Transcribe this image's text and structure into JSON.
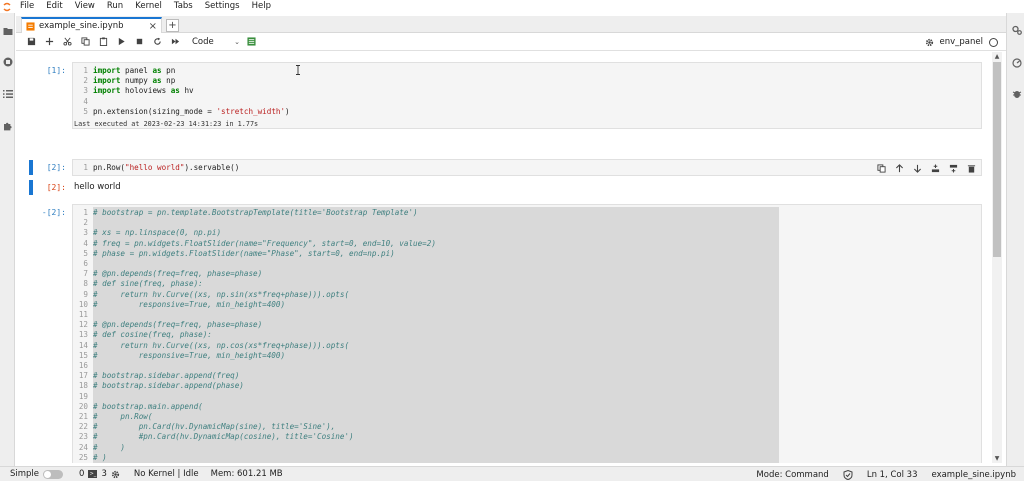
{
  "menu": [
    "File",
    "Edit",
    "View",
    "Run",
    "Kernel",
    "Tabs",
    "Settings",
    "Help"
  ],
  "tab": {
    "label": "example_sine.ipynb",
    "close": "×",
    "new": "+"
  },
  "toolbar": {
    "cell_type": "Code",
    "kernel_name": "env_panel"
  },
  "cells": [
    {
      "prompt": "[1]:",
      "lines": [
        {
          "n": "1",
          "parts": [
            {
              "t": "import",
              "c": "kw"
            },
            {
              "t": " panel ",
              "c": ""
            },
            {
              "t": "as",
              "c": "kw"
            },
            {
              "t": " pn",
              "c": ""
            }
          ]
        },
        {
          "n": "2",
          "parts": [
            {
              "t": "import",
              "c": "kw"
            },
            {
              "t": " numpy ",
              "c": ""
            },
            {
              "t": "as",
              "c": "kw"
            },
            {
              "t": " np",
              "c": ""
            }
          ]
        },
        {
          "n": "3",
          "parts": [
            {
              "t": "import",
              "c": "kw"
            },
            {
              "t": " holoviews ",
              "c": ""
            },
            {
              "t": "as",
              "c": "kw"
            },
            {
              "t": " hv",
              "c": ""
            }
          ]
        },
        {
          "n": "4",
          "parts": [
            {
              "t": "",
              "c": ""
            }
          ]
        },
        {
          "n": "5",
          "parts": [
            {
              "t": "pn.extension(sizing_mode = ",
              "c": ""
            },
            {
              "t": "'stretch_width'",
              "c": "str"
            },
            {
              "t": ")",
              "c": ""
            }
          ]
        }
      ],
      "exec_info": "Last executed at 2023-02-23 14:31:23 in 1.77s"
    },
    {
      "prompt": "[2]:",
      "lines": [
        {
          "n": "1",
          "parts": [
            {
              "t": "pn.Row(",
              "c": ""
            },
            {
              "t": "\"hello world\"",
              "c": "str"
            },
            {
              "t": ").servable()",
              "c": ""
            }
          ]
        }
      ],
      "output_prompt": "[2]:",
      "output": "hello world"
    },
    {
      "prompt": "-[2]:",
      "lines": [
        {
          "n": "1",
          "parts": [
            {
              "t": "# bootstrap = pn.template.BootstrapTemplate(title='Bootstrap Template')",
              "c": "cm"
            }
          ]
        },
        {
          "n": "2",
          "parts": [
            {
              "t": "",
              "c": ""
            }
          ]
        },
        {
          "n": "3",
          "parts": [
            {
              "t": "# xs = np.linspace(0, np.pi)",
              "c": "cm"
            }
          ]
        },
        {
          "n": "4",
          "parts": [
            {
              "t": "# freq = pn.widgets.FloatSlider(name=\"Frequency\", start=0, end=10, value=2)",
              "c": "cm"
            }
          ]
        },
        {
          "n": "5",
          "parts": [
            {
              "t": "# phase = pn.widgets.FloatSlider(name=\"Phase\", start=0, end=np.pi)",
              "c": "cm"
            }
          ]
        },
        {
          "n": "6",
          "parts": [
            {
              "t": "",
              "c": ""
            }
          ]
        },
        {
          "n": "7",
          "parts": [
            {
              "t": "# @pn.depends(freq=freq, phase=phase)",
              "c": "cm"
            }
          ]
        },
        {
          "n": "8",
          "parts": [
            {
              "t": "# def sine(freq, phase):",
              "c": "cm"
            }
          ]
        },
        {
          "n": "9",
          "parts": [
            {
              "t": "#     return hv.Curve((xs, np.sin(xs*freq+phase))).opts(",
              "c": "cm"
            }
          ]
        },
        {
          "n": "10",
          "parts": [
            {
              "t": "#         responsive=True, min_height=400)",
              "c": "cm"
            }
          ]
        },
        {
          "n": "11",
          "parts": [
            {
              "t": "",
              "c": ""
            }
          ]
        },
        {
          "n": "12",
          "parts": [
            {
              "t": "# @pn.depends(freq=freq, phase=phase)",
              "c": "cm"
            }
          ]
        },
        {
          "n": "13",
          "parts": [
            {
              "t": "# def cosine(freq, phase):",
              "c": "cm"
            }
          ]
        },
        {
          "n": "14",
          "parts": [
            {
              "t": "#     return hv.Curve((xs, np.cos(xs*freq+phase))).opts(",
              "c": "cm"
            }
          ]
        },
        {
          "n": "15",
          "parts": [
            {
              "t": "#         responsive=True, min_height=400)",
              "c": "cm"
            }
          ]
        },
        {
          "n": "16",
          "parts": [
            {
              "t": "",
              "c": ""
            }
          ]
        },
        {
          "n": "17",
          "parts": [
            {
              "t": "# bootstrap.sidebar.append(freq)",
              "c": "cm"
            }
          ]
        },
        {
          "n": "18",
          "parts": [
            {
              "t": "# bootstrap.sidebar.append(phase)",
              "c": "cm"
            }
          ]
        },
        {
          "n": "19",
          "parts": [
            {
              "t": "",
              "c": ""
            }
          ]
        },
        {
          "n": "20",
          "parts": [
            {
              "t": "# bootstrap.main.append(",
              "c": "cm"
            }
          ]
        },
        {
          "n": "21",
          "parts": [
            {
              "t": "#     pn.Row(",
              "c": "cm"
            }
          ]
        },
        {
          "n": "22",
          "parts": [
            {
              "t": "#         pn.Card(hv.DynamicMap(sine), title='Sine'),",
              "c": "cm"
            }
          ]
        },
        {
          "n": "23",
          "parts": [
            {
              "t": "#         #pn.Card(hv.DynamicMap(cosine), title='Cosine')",
              "c": "cm"
            }
          ]
        },
        {
          "n": "24",
          "parts": [
            {
              "t": "#     )",
              "c": "cm"
            }
          ]
        },
        {
          "n": "25",
          "parts": [
            {
              "t": "# )",
              "c": "cm"
            }
          ]
        }
      ]
    }
  ],
  "status": {
    "mode_label": "Simple",
    "terminals": "0",
    "kernels": "3",
    "kernel_status": "No Kernel | Idle",
    "memory": "Mem: 601.21 MB",
    "mode": "Mode: Command",
    "position": "Ln 1, Col 33",
    "filename": "example_sine.ipynb"
  },
  "colors": {
    "accent": "#1976d2",
    "prompt": "#307fc1",
    "selection": "#d9d9d9"
  }
}
